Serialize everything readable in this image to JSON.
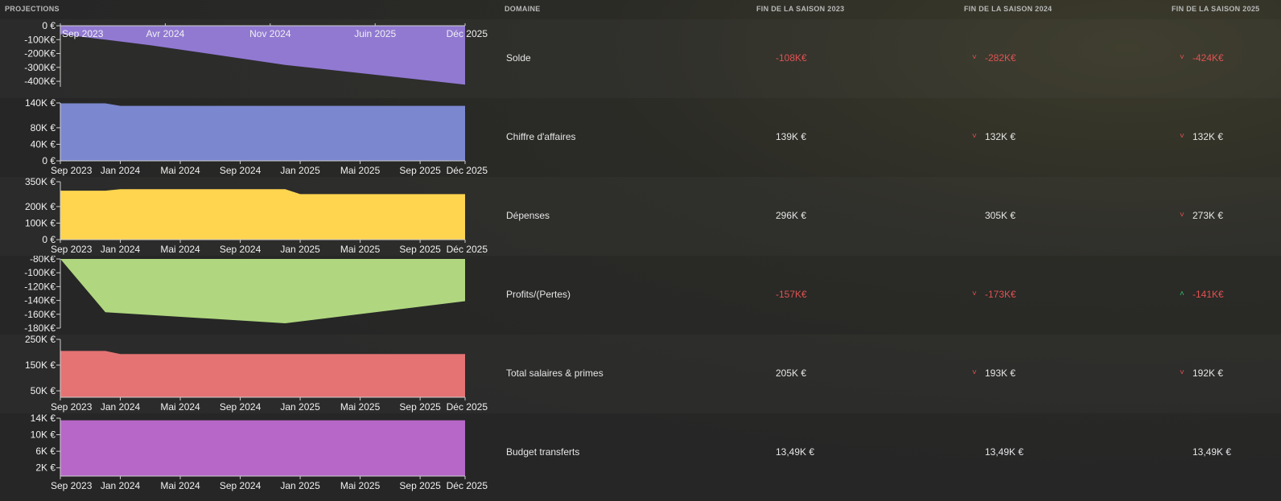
{
  "header": {
    "projections": "PROJECTIONS",
    "domaine": "DOMAINE",
    "season2023": "FIN DE LA SAISON 2023",
    "season2024": "FIN DE LA SAISON 2024",
    "season2025": "FIN DE LA SAISON 2025"
  },
  "rows": [
    {
      "domain": "Solde",
      "v2023": "-108K€",
      "v2024": "-282K€",
      "v2025": "-424K€",
      "neg2023": true,
      "neg2024": true,
      "neg2025": true,
      "trend2024": "down",
      "trend2025": "down"
    },
    {
      "domain": "Chiffre d'affaires",
      "v2023": "139K €",
      "v2024": "132K €",
      "v2025": "132K €",
      "neg2023": false,
      "neg2024": false,
      "neg2025": false,
      "trend2024": "down",
      "trend2025": "down"
    },
    {
      "domain": "Dépenses",
      "v2023": "296K €",
      "v2024": "305K €",
      "v2025": "273K €",
      "neg2023": false,
      "neg2024": false,
      "neg2025": false,
      "trend2024": "none",
      "trend2025": "down"
    },
    {
      "domain": "Profits/(Pertes)",
      "v2023": "-157K€",
      "v2024": "-173K€",
      "v2025": "-141K€",
      "neg2023": true,
      "neg2024": true,
      "neg2025": true,
      "trend2024": "down",
      "trend2025": "up"
    },
    {
      "domain": "Total salaires & primes",
      "v2023": "205K €",
      "v2024": "193K €",
      "v2025": "192K €",
      "neg2023": false,
      "neg2024": false,
      "neg2025": false,
      "trend2024": "down",
      "trend2025": "down"
    },
    {
      "domain": "Budget transferts",
      "v2023": "13,49K €",
      "v2024": "13,49K €",
      "v2025": "13,49K €",
      "neg2023": false,
      "neg2024": false,
      "neg2025": false,
      "trend2024": "none",
      "trend2025": "none"
    }
  ],
  "chart_data": [
    {
      "type": "area",
      "color": "#9179d2",
      "baseline": "top",
      "x": [
        "2023-09",
        "2023-12",
        "2024-03",
        "2024-12",
        "2025-12"
      ],
      "values": [
        -60,
        -100,
        -140,
        -282,
        -424
      ],
      "ylim": [
        -440,
        0
      ],
      "yticks": [
        0,
        -100,
        -200,
        -300,
        -400
      ],
      "ytick_labels": [
        "0 €",
        "-100K€",
        "-200K€",
        "-300K€",
        "-400K€"
      ],
      "xticks": [
        "2023-09",
        "2024-04",
        "2024-11",
        "2025-06",
        "2025-12"
      ],
      "xtick_labels": [
        "Sep 2023",
        "Avr 2024",
        "Nov 2024",
        "Juin 2025",
        "Déc 2025"
      ],
      "xaxis": "top"
    },
    {
      "type": "area",
      "color": "#7b87cf",
      "baseline": "bottom",
      "x": [
        "2023-09",
        "2023-12",
        "2024-01",
        "2025-12"
      ],
      "values": [
        139,
        139,
        133,
        133
      ],
      "ylim": [
        0,
        140
      ],
      "yticks": [
        0,
        40,
        80,
        140
      ],
      "ytick_labels": [
        "0 €",
        "40K €",
        "80K €",
        "140K €"
      ],
      "xticks": [
        "2023-09",
        "2024-01",
        "2024-05",
        "2024-09",
        "2025-01",
        "2025-05",
        "2025-09",
        "2025-12"
      ],
      "xtick_labels": [
        "Sep 2023",
        "Jan 2024",
        "Mai 2024",
        "Sep 2024",
        "Jan 2025",
        "Mai 2025",
        "Sep 2025",
        "Déc 2025"
      ],
      "xaxis": "bottom"
    },
    {
      "type": "area",
      "color": "#ffd54f",
      "baseline": "bottom",
      "x": [
        "2023-09",
        "2023-12",
        "2024-01",
        "2024-12",
        "2025-01",
        "2025-12"
      ],
      "values": [
        296,
        296,
        305,
        305,
        275,
        275
      ],
      "ylim": [
        0,
        350
      ],
      "yticks": [
        0,
        100,
        200,
        350
      ],
      "ytick_labels": [
        "0 €",
        "100K €",
        "200K €",
        "350K €"
      ],
      "xticks": [
        "2023-09",
        "2024-01",
        "2024-05",
        "2024-09",
        "2025-01",
        "2025-05",
        "2025-09",
        "2025-12"
      ],
      "xtick_labels": [
        "Sep 2023",
        "Jan 2024",
        "Mai 2024",
        "Sep 2024",
        "Jan 2025",
        "Mai 2025",
        "Sep 2025",
        "Déc 2025"
      ],
      "xaxis": "bottom"
    },
    {
      "type": "area",
      "color": "#b0d77f",
      "baseline": "top",
      "x": [
        "2023-09",
        "2023-12",
        "2024-12",
        "2025-12"
      ],
      "values": [
        -80,
        -157,
        -173,
        -141
      ],
      "ylim": [
        -180,
        -80
      ],
      "yticks": [
        -80,
        -100,
        -120,
        -140,
        -160,
        -180
      ],
      "ytick_labels": [
        "-80K€",
        "-100K€",
        "-120K€",
        "-140K€",
        "-160K€",
        "-180K€"
      ],
      "xticks": [],
      "xtick_labels": [],
      "xaxis": "none"
    },
    {
      "type": "area",
      "color": "#e57373",
      "baseline": "bottom",
      "x": [
        "2023-09",
        "2023-12",
        "2024-01",
        "2025-12"
      ],
      "values": [
        205,
        205,
        193,
        193
      ],
      "ylim": [
        25,
        250
      ],
      "yticks": [
        50,
        150,
        250
      ],
      "ytick_labels": [
        "50K €",
        "150K €",
        "250K €"
      ],
      "xticks": [
        "2023-09",
        "2024-01",
        "2024-05",
        "2024-09",
        "2025-01",
        "2025-05",
        "2025-09",
        "2025-12"
      ],
      "xtick_labels": [
        "Sep 2023",
        "Jan 2024",
        "Mai 2024",
        "Sep 2024",
        "Jan 2025",
        "Mai 2025",
        "Sep 2025",
        "Déc 2025"
      ],
      "xaxis": "bottom"
    },
    {
      "type": "area",
      "color": "#b667c7",
      "baseline": "bottom",
      "x": [
        "2023-09",
        "2025-12"
      ],
      "values": [
        13.49,
        13.49
      ],
      "ylim": [
        0,
        14
      ],
      "yticks": [
        2,
        6,
        10,
        14
      ],
      "ytick_labels": [
        "2K €",
        "6K €",
        "10K €",
        "14K €"
      ],
      "xticks": [
        "2023-09",
        "2024-01",
        "2024-05",
        "2024-09",
        "2025-01",
        "2025-05",
        "2025-09",
        "2025-12"
      ],
      "xtick_labels": [
        "Sep 2023",
        "Jan 2024",
        "Mai 2024",
        "Sep 2024",
        "Jan 2025",
        "Mai 2025",
        "Sep 2025",
        "Déc 2025"
      ],
      "xaxis": "bottom"
    }
  ]
}
